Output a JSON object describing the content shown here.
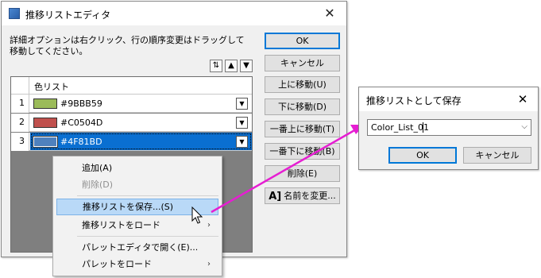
{
  "main_dialog": {
    "title": "推移リストエディタ",
    "close_glyph": "✕",
    "instructions": "詳細オプションは右クリック、行の順序変更はドラッグして移動してください。",
    "sort_buttons": {
      "sort": "⇅",
      "up": "▲",
      "down": "▼"
    },
    "grid": {
      "column_header": "色リスト",
      "rows": [
        {
          "num": "1",
          "color": "#9BBB59",
          "label": "#9BBB59"
        },
        {
          "num": "2",
          "color": "#C0504D",
          "label": "#C0504D"
        },
        {
          "num": "3",
          "color": "#4F81BD",
          "label": "#4F81BD"
        }
      ],
      "dropdown_glyph": "▼"
    },
    "buttons": {
      "ok": "OK",
      "cancel": "キャンセル",
      "move_up": "上に移動(U)",
      "move_down": "下に移動(D)",
      "move_top": "一番上に移動(T)",
      "move_bottom": "一番下に移動(B)",
      "delete": "削除(E)",
      "rename_icon": "A]",
      "rename": "名前を変更..."
    }
  },
  "context_menu": {
    "add": "追加(A)",
    "delete": "削除(D)",
    "save_list": "推移リストを保存...(S)",
    "load_list": "推移リストをロード",
    "open_palette_editor": "パレットエディタで開く(E)...",
    "load_palette": "パレットをロード",
    "submenu_glyph": "›"
  },
  "save_dialog": {
    "title": "推移リストとして保存",
    "close_glyph": "✕",
    "input_value": "Color_List_01",
    "combo_arrow": "⌵",
    "ok": "OK",
    "cancel": "キャンセル"
  },
  "colors": {
    "selection": "#0A6FD1",
    "connector": "#E61ED2",
    "menu_hover": "#B9D9F7"
  }
}
